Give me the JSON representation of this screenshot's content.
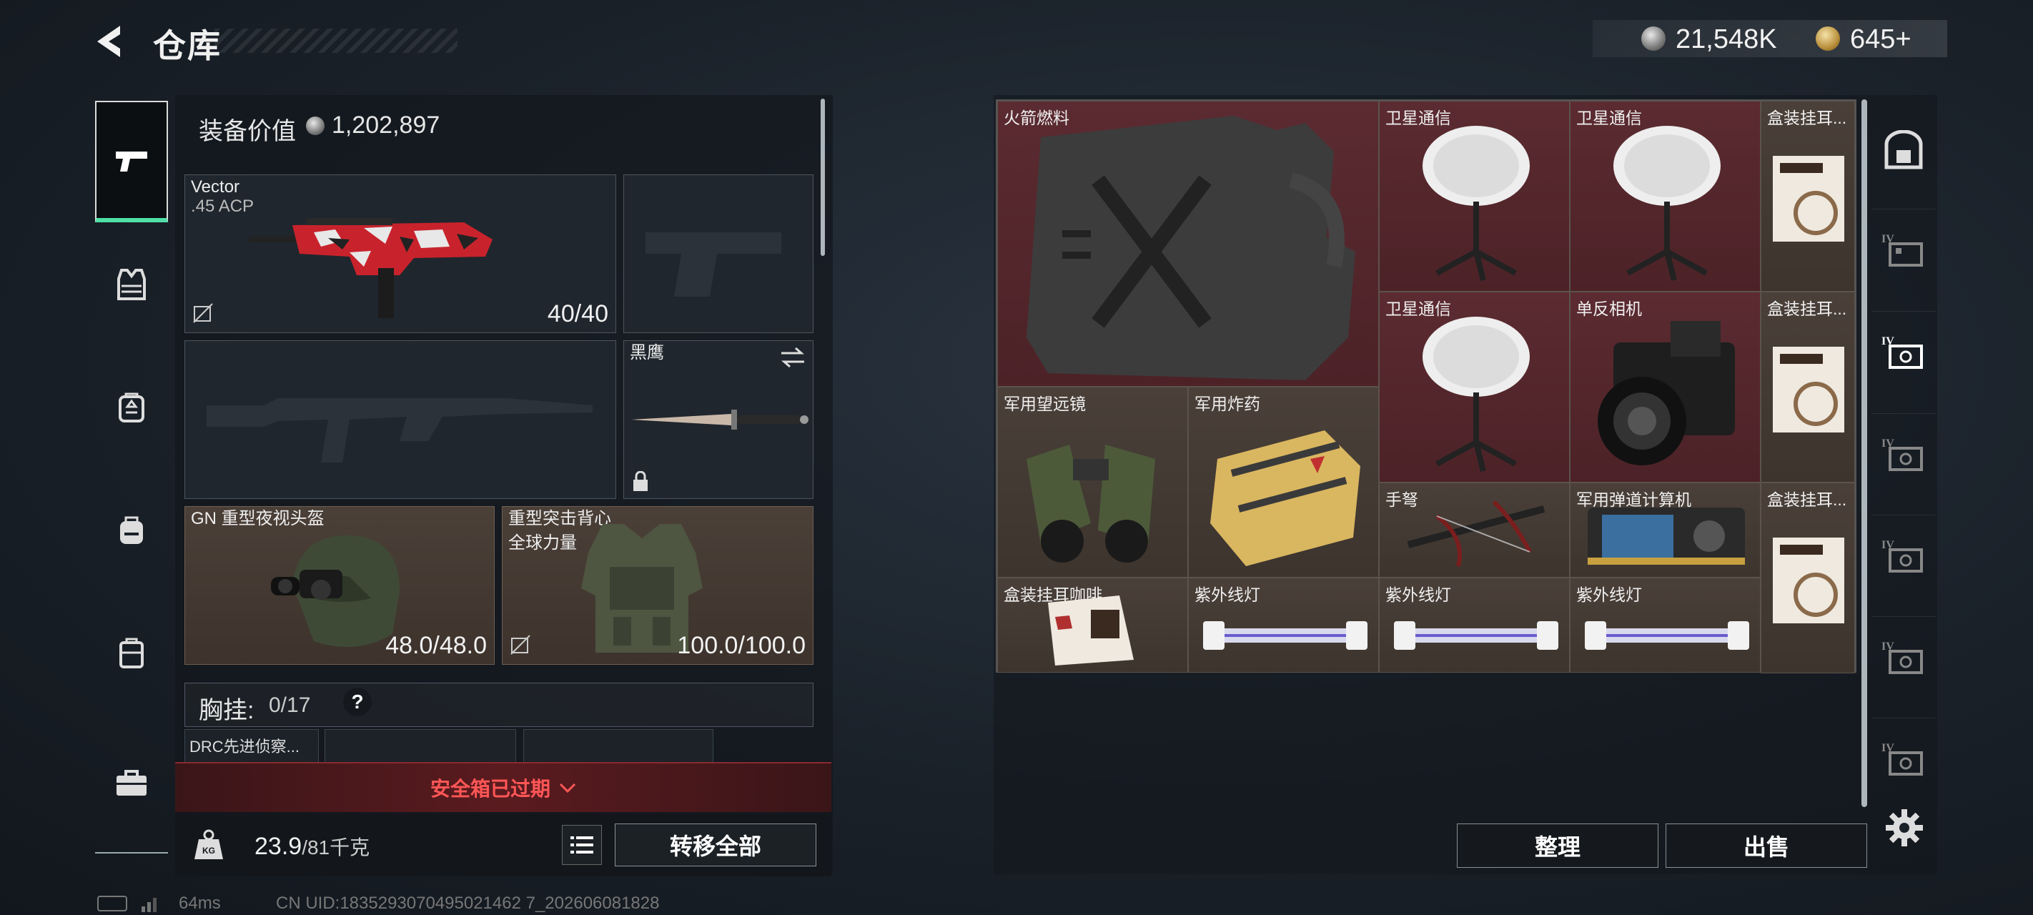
{
  "header": {
    "title": "仓库",
    "currency_silver": "21,548K",
    "currency_gold": "645+"
  },
  "left_nav": [
    "pistol-icon",
    "vest-icon",
    "backpack-icon",
    "bag-icon",
    "case-icon",
    "toolbox-icon"
  ],
  "equipment": {
    "value_label": "装备价值",
    "value": "1,202,897",
    "primary": {
      "name": "Vector",
      "ammo": ".45 ACP",
      "count": "40/40"
    },
    "melee": {
      "name": "黑鹰"
    },
    "helmet": {
      "name": "GN 重型夜视头盔",
      "durability": "48.0/48.0"
    },
    "armor": {
      "name_line1": "重型突击背心",
      "name_line2": "全球力量",
      "durability": "100.0/100.0"
    },
    "chest_rig_label": "胸挂:",
    "chest_rig_count": "0/17",
    "help": "?",
    "rig_item": "DRC先进侦察..."
  },
  "safe_box_expired": "安全箱已过期",
  "weight": {
    "value": "23.9",
    "max": "/81千克"
  },
  "transfer_all": "转移全部",
  "status": {
    "ping": "64ms",
    "uid": "CN UID:1835293070495021462 7_202606081828"
  },
  "stash_items": [
    {
      "name": "火箭燃料"
    },
    {
      "name": "卫星通信"
    },
    {
      "name": "卫星通信"
    },
    {
      "name": "盒装挂耳..."
    },
    {
      "name": "卫星通信"
    },
    {
      "name": "单反相机"
    },
    {
      "name": "盒装挂耳..."
    },
    {
      "name": "军用望远镜"
    },
    {
      "name": "军用炸药"
    },
    {
      "name": "手弩"
    },
    {
      "name": "军用弹道计算机"
    },
    {
      "name": "盒装挂耳..."
    },
    {
      "name": "盒装挂耳咖啡"
    },
    {
      "name": "紫外线灯"
    },
    {
      "name": "紫外线灯"
    },
    {
      "name": "紫外线灯"
    }
  ],
  "sort_label": "整理",
  "sell_label": "出售",
  "right_nav": [
    "safe-icon",
    "case-iv-icon",
    "case-iv-icon",
    "case-iv-icon",
    "case-iv-icon",
    "case-iv-icon",
    "case-iv-icon"
  ],
  "colors": {
    "accent_green": "#4fe0a8",
    "expired_red": "#ff5656",
    "rare_cell": "#5b2b31"
  }
}
